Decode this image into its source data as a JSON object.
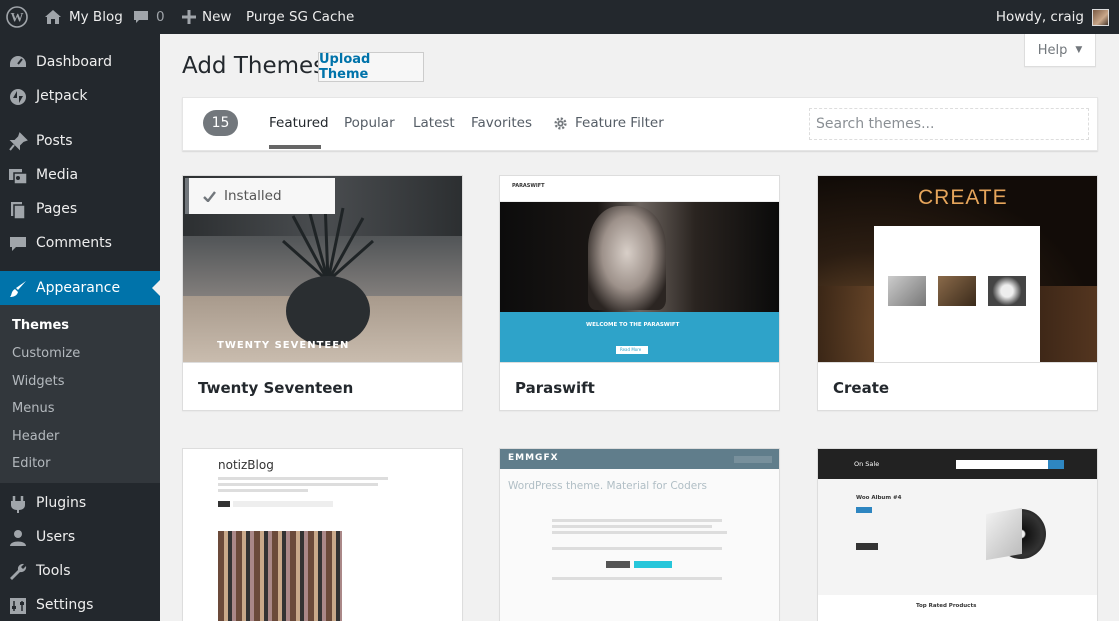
{
  "adminbar": {
    "site_name": "My Blog",
    "comments_count": "0",
    "new_label": "New",
    "purge_label": "Purge SG Cache",
    "howdy": "Howdy, craig"
  },
  "sidebar": {
    "items": [
      {
        "label": "Dashboard",
        "icon": "dashboard-icon"
      },
      {
        "label": "Jetpack",
        "icon": "jetpack-icon"
      },
      {
        "label": "Posts",
        "icon": "pin-icon"
      },
      {
        "label": "Media",
        "icon": "media-icon"
      },
      {
        "label": "Pages",
        "icon": "pages-icon"
      },
      {
        "label": "Comments",
        "icon": "comment-icon"
      },
      {
        "label": "Appearance",
        "icon": "brush-icon"
      },
      {
        "label": "Plugins",
        "icon": "plug-icon"
      },
      {
        "label": "Users",
        "icon": "users-icon"
      },
      {
        "label": "Tools",
        "icon": "wrench-icon"
      },
      {
        "label": "Settings",
        "icon": "settings-icon"
      }
    ],
    "submenu": [
      "Themes",
      "Customize",
      "Widgets",
      "Menus",
      "Header",
      "Editor"
    ]
  },
  "help": {
    "label": "Help"
  },
  "main": {
    "title": "Add Themes",
    "upload_label": "Upload Theme",
    "filter": {
      "count": "15",
      "tabs": [
        "Featured",
        "Popular",
        "Latest",
        "Favorites"
      ],
      "feature_filter": "Feature Filter",
      "search_placeholder": "Search themes..."
    },
    "installed_label": "Installed",
    "themes": [
      {
        "name": "Twenty Seventeen"
      },
      {
        "name": "Paraswift"
      },
      {
        "name": "Create"
      },
      {
        "name": ""
      },
      {
        "name": ""
      },
      {
        "name": ""
      }
    ],
    "previews": {
      "twentyseventeen_caption": "TWENTY SEVENTEEN",
      "paraswift_logo": "PARASWIFT",
      "paraswift_welcome": "WELCOME TO THE PARASWIFT",
      "paraswift_button": "Read More",
      "create_heading": "CREATE",
      "notiz_title": "notizBlog",
      "emmgfx_logo": "EMMGFX",
      "emmgfx_heading": "WordPress theme. Material for Coders",
      "shop_onsale": "On Sale",
      "shop_album": "Woo Album #4",
      "shop_top_rated": "Top Rated Products"
    }
  },
  "colors": {
    "admin_dark": "#23282d",
    "accent": "#0073aa",
    "paraswift_blue": "#2ea3c9"
  }
}
